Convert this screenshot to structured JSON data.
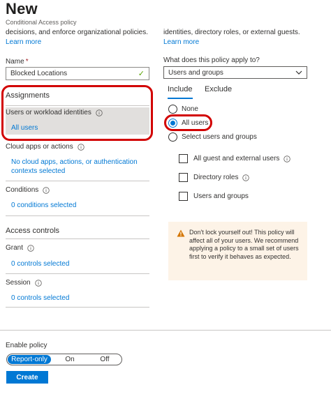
{
  "header": {
    "title": "New",
    "subtitle": "Conditional Access policy"
  },
  "left": {
    "description_fragment": "decisions, and enforce organizational policies.",
    "learn_more": "Learn more",
    "name_label": "Name",
    "name_required_mark": "*",
    "name_value": "Blocked Locations",
    "assignments_title": "Assignments",
    "users_label": "Users or workload identities",
    "users_value": "All users",
    "cloud_apps_label": "Cloud apps or actions",
    "cloud_apps_value": "No cloud apps, actions, or authentication contexts selected",
    "conditions_label": "Conditions",
    "conditions_value": "0 conditions selected",
    "access_controls_title": "Access controls",
    "grant_label": "Grant",
    "grant_value": "0 controls selected",
    "session_label": "Session",
    "session_value": "0 controls selected"
  },
  "right": {
    "description_fragment": "identities, directory roles, or external guests.",
    "learn_more": "Learn more",
    "applies_to_label": "What does this policy apply to?",
    "applies_to_value": "Users and groups",
    "tabs": [
      {
        "label": "Include",
        "active": true
      },
      {
        "label": "Exclude",
        "active": false
      }
    ],
    "radios": [
      {
        "label": "None",
        "selected": false
      },
      {
        "label": "All users",
        "selected": true
      },
      {
        "label": "Select users and groups",
        "selected": false
      }
    ],
    "checkboxes": [
      {
        "label": "All guest and external users",
        "checked": false
      },
      {
        "label": "Directory roles",
        "checked": false
      },
      {
        "label": "Users and groups",
        "checked": false
      }
    ],
    "warning": "Don't lock yourself out! This policy will affect all of your users. We recommend applying a policy to a small set of users first to verify it behaves as expected."
  },
  "footer": {
    "enable_policy_label": "Enable policy",
    "toggle_options": [
      "Report-only",
      "On",
      "Off"
    ],
    "toggle_selected": "Report-only",
    "create_label": "Create"
  },
  "colors": {
    "accent": "#0078d4",
    "highlight_box": "#d20000",
    "warning_bg": "#fdf3e7",
    "warning_icon": "#d47500",
    "valid_check": "#57a300"
  }
}
